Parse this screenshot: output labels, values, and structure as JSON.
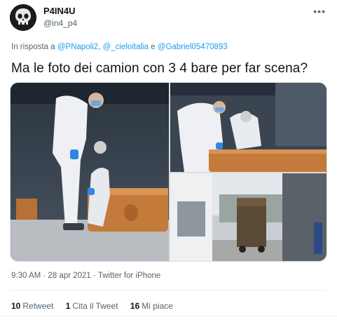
{
  "author": {
    "display_name": "P4IN4U",
    "handle": "@in4_p4",
    "avatar_icon": "skull-avatar-icon"
  },
  "more_icon": "more-icon",
  "reply_context": {
    "prefix": "In risposta a",
    "mention1": "@PNapoli2",
    "sep1": ", ",
    "mention2": "@_cieloitalia",
    "sep2": " e ",
    "mention3": "@Gabriel05470893"
  },
  "tweet": {
    "text": "Ma le foto dei camion con 3 4 bare per far scena?"
  },
  "meta": {
    "time": "9:30 AM",
    "dot1": " · ",
    "date": "28 apr 2021",
    "dot2": " · ",
    "source": "Twitter for iPhone"
  },
  "stats": [
    {
      "count": "10",
      "label": "Retweet"
    },
    {
      "count": "1",
      "label": "Cita il Tweet"
    },
    {
      "count": "16",
      "label": "Mi piace"
    }
  ],
  "colors": {
    "link": "#1d9bf0",
    "secondary_text": "#536471",
    "primary_text": "#0f1419",
    "coffin_wood": "#c47a3a",
    "protective_suit": "#eef0f3",
    "glove_blue": "#2f86e8"
  }
}
